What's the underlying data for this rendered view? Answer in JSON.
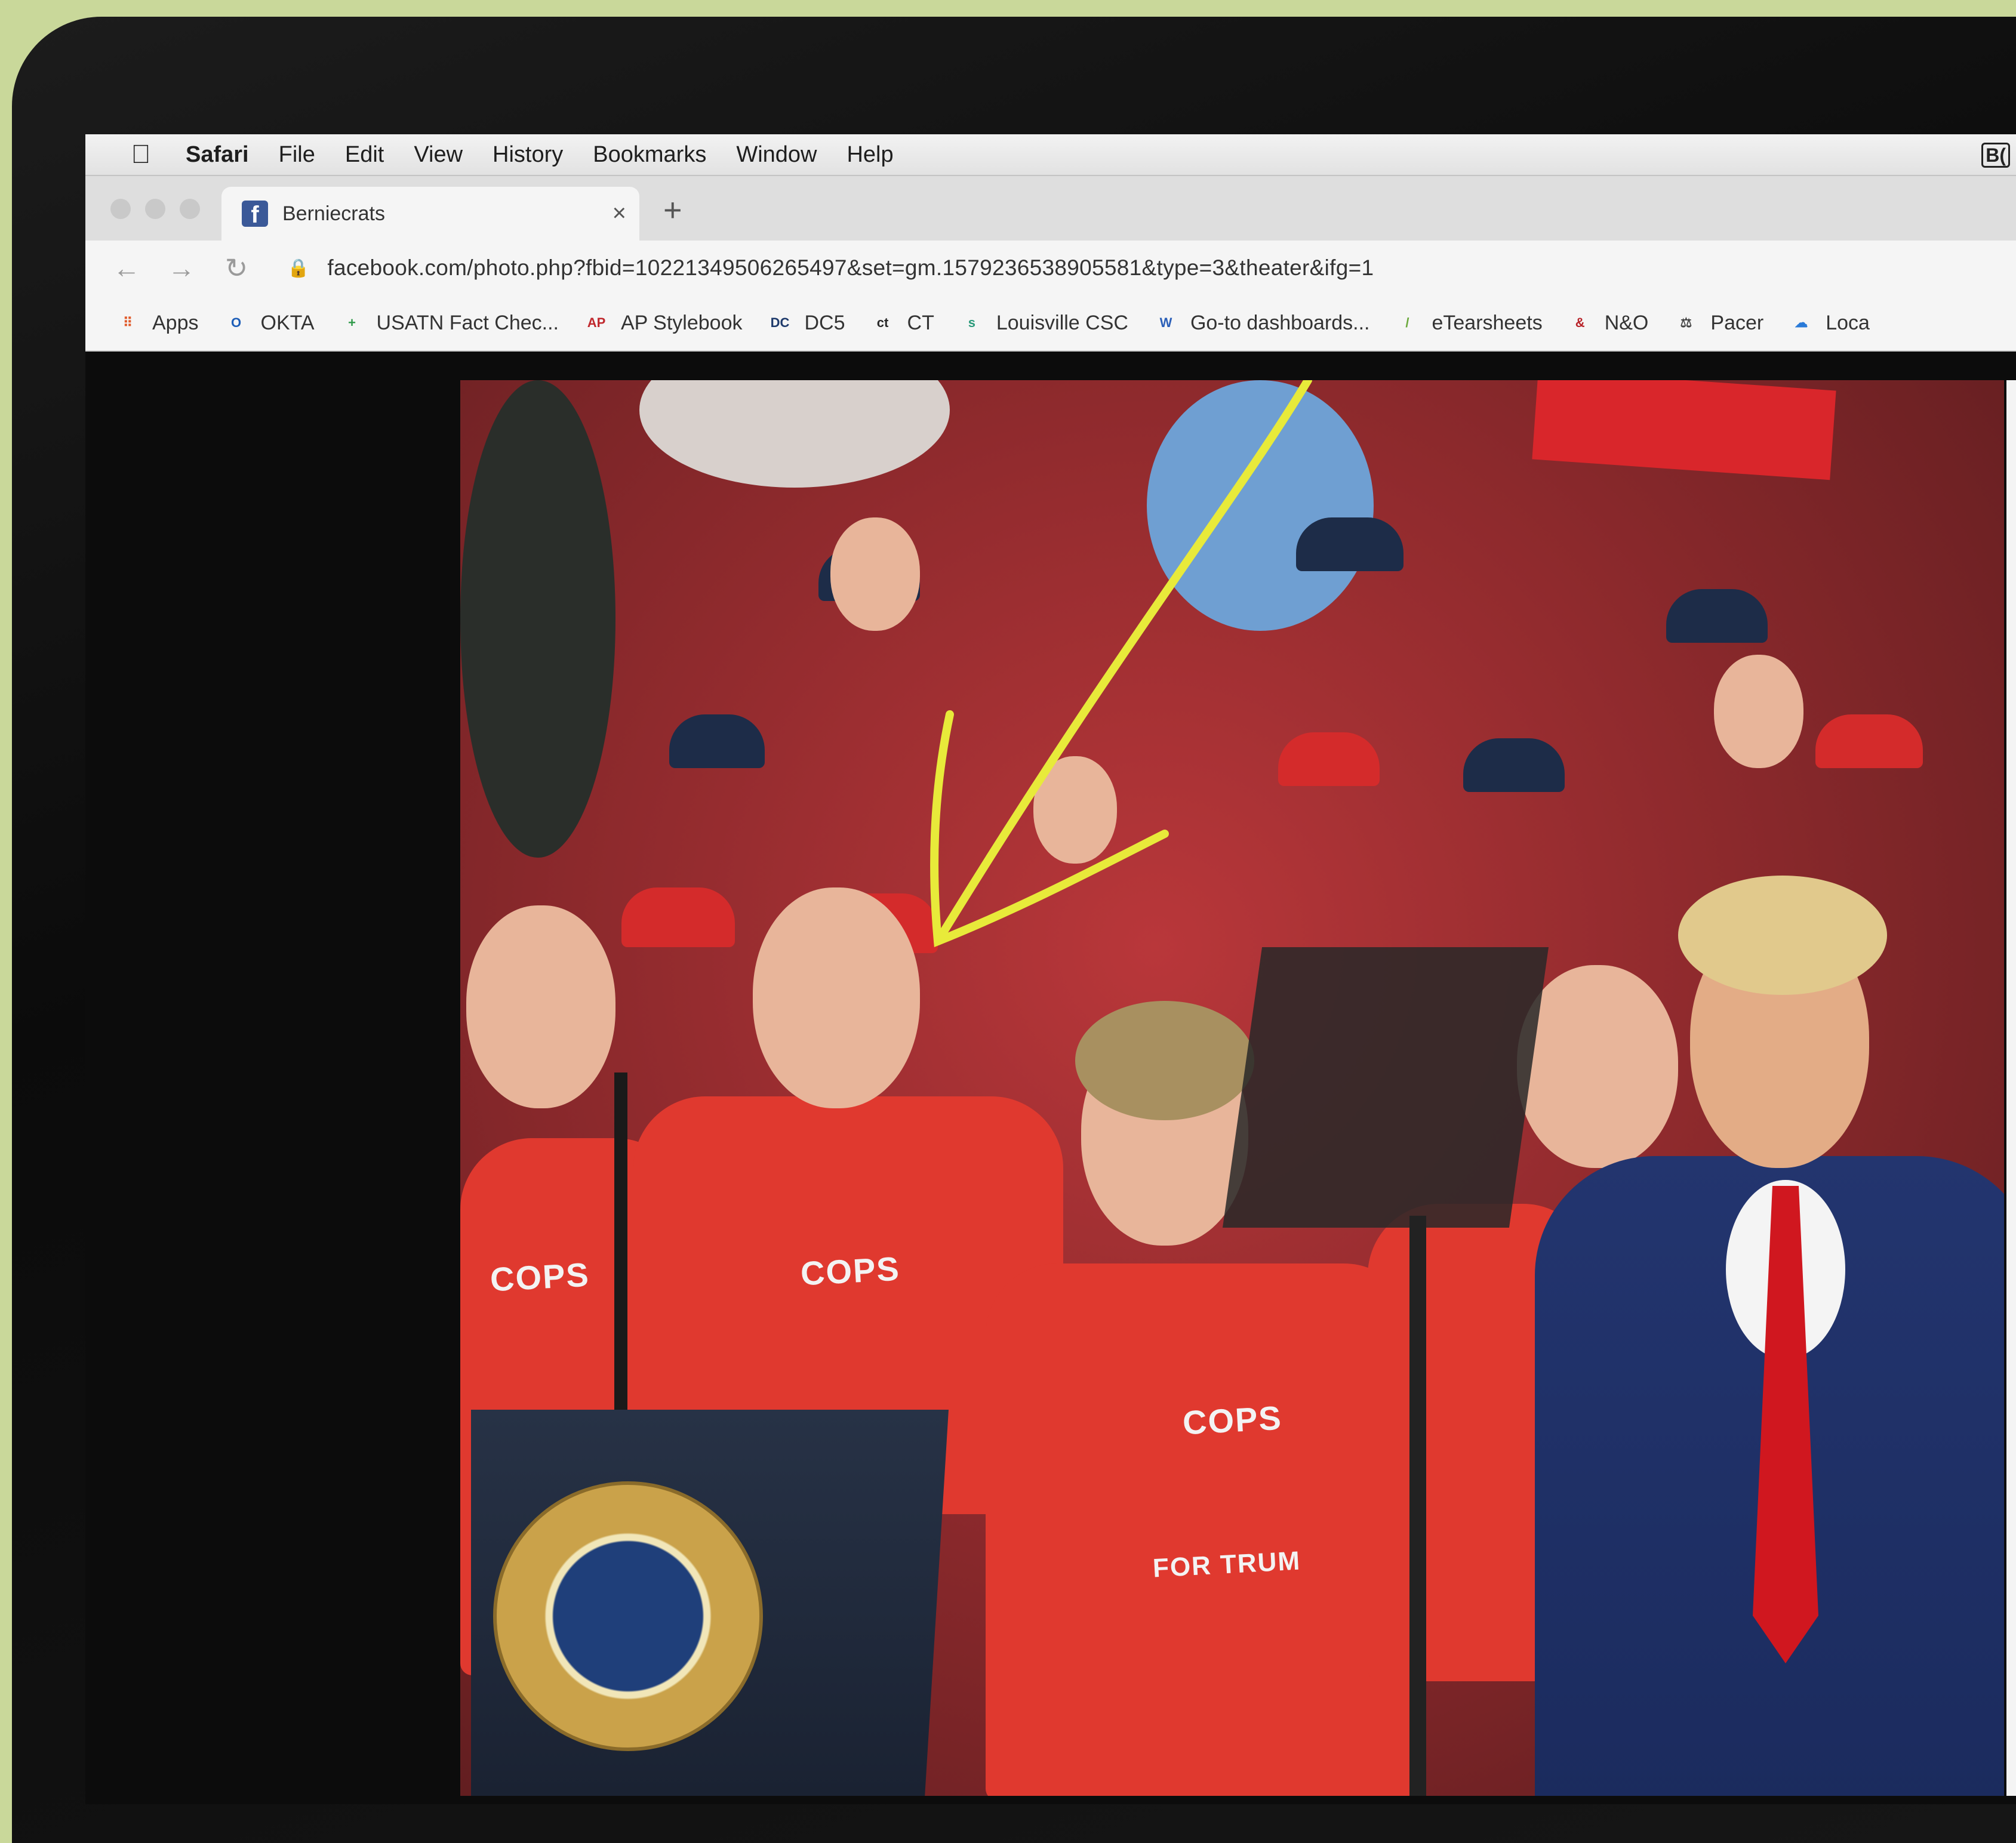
{
  "menubar": {
    "apple_icon": "apple-icon",
    "app_name": "Safari",
    "items": [
      "File",
      "Edit",
      "View",
      "History",
      "Bookmarks",
      "Window",
      "Help"
    ],
    "status_item": "B("
  },
  "tab": {
    "favicon": "facebook-icon",
    "title": "Berniecrats",
    "close_label": "×",
    "new_tab_label": "+"
  },
  "toolbar": {
    "back_label": "←",
    "forward_label": "→",
    "reload_label": "↻",
    "lock_icon": "lock-icon",
    "url": "facebook.com/photo.php?fbid=10221349506265497&set=gm.1579236538905581&type=3&theater&ifg=1"
  },
  "bookmarks": [
    {
      "label": "Apps",
      "icon": "apps-grid-icon",
      "glyph": "⠿",
      "color": "#e05a2a"
    },
    {
      "label": "OKTA",
      "icon": "okta-icon",
      "glyph": "O",
      "color": "#1f5fb8"
    },
    {
      "label": "USATN Fact Chec...",
      "icon": "usatn-icon",
      "glyph": "+",
      "color": "#2f9a4a"
    },
    {
      "label": "AP Stylebook",
      "icon": "ap-icon",
      "glyph": "AP",
      "color": "#c0282d"
    },
    {
      "label": "DC5",
      "icon": "dc5-icon",
      "glyph": "DC",
      "color": "#1e3a6b"
    },
    {
      "label": "CT",
      "icon": "ct-icon",
      "glyph": "ct",
      "color": "#2a2a2a"
    },
    {
      "label": "Louisville CSC",
      "icon": "louisville-icon",
      "glyph": "s",
      "color": "#2a9a7a"
    },
    {
      "label": "Go-to dashboards...",
      "icon": "word-icon",
      "glyph": "W",
      "color": "#2b5fb8"
    },
    {
      "label": "eTearsheets",
      "icon": "etearsheets-icon",
      "glyph": "/",
      "color": "#6aa83a"
    },
    {
      "label": "N&O",
      "icon": "no-icon",
      "glyph": "&",
      "color": "#b8242a"
    },
    {
      "label": "Pacer",
      "icon": "scales-icon",
      "glyph": "⚖",
      "color": "#444444"
    },
    {
      "label": "Loca",
      "icon": "cloud-icon",
      "glyph": "☁",
      "color": "#2a7ad8"
    }
  ],
  "photo": {
    "shirt_texts": [
      "COPS",
      "COPS",
      "COPS",
      "FOR TRUM"
    ],
    "arrow_color": "#e8ea3a"
  }
}
